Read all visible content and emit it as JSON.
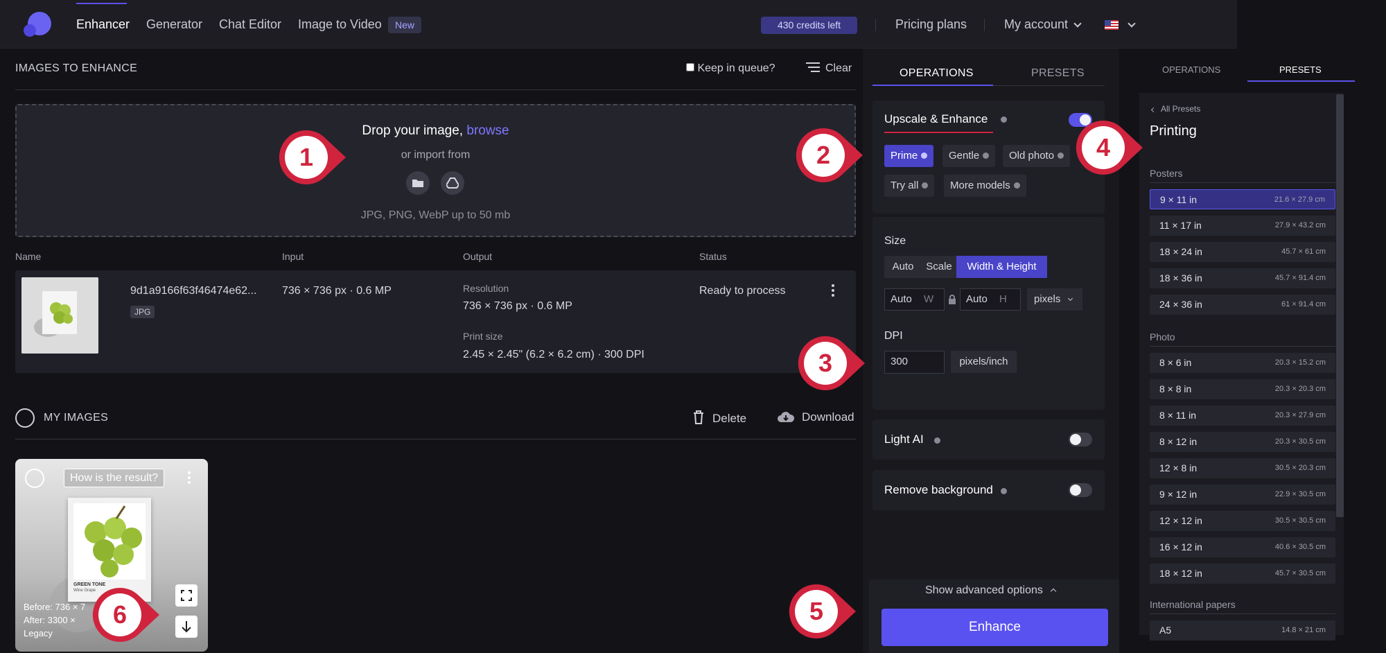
{
  "nav": {
    "items": [
      "Enhancer",
      "Generator",
      "Chat Editor",
      "Image to Video"
    ],
    "new_badge": "New",
    "credits": "430 credits left",
    "pricing": "Pricing plans",
    "account": "My account"
  },
  "images": {
    "title": "IMAGES TO ENHANCE",
    "keep_queue": "Keep in queue?",
    "clear": "Clear",
    "drop_text": "Drop your image,",
    "browse": "browse",
    "import_from": "or import from",
    "formats": "JPG, PNG, WebP up to 50 mb",
    "columns": {
      "name": "Name",
      "input": "Input",
      "output": "Output",
      "status": "Status"
    },
    "row": {
      "filename": "9d1a9166f63f46474e62...",
      "type": "JPG",
      "input": "736 × 736 px · 0.6 MP",
      "resolution_label": "Resolution",
      "resolution": "736 × 736 px · 0.6 MP",
      "print_label": "Print size",
      "print_size": "2.45 × 2.45\" (6.2 × 6.2 cm) · 300 DPI",
      "status": "Ready to process"
    }
  },
  "my_images": {
    "title": "MY IMAGES",
    "delete": "Delete",
    "download": "Download",
    "card": {
      "question": "How is the result?",
      "before": "Before:  736 × 7",
      "after": "After:    3300 ×",
      "model": "Legacy",
      "poster_title": "GREEN TONE",
      "poster_sub": "Wine Grape"
    }
  },
  "operations": {
    "tab_operations": "OPERATIONS",
    "tab_presets": "PRESETS",
    "upscale_title": "Upscale & Enhance",
    "models": [
      "Prime",
      "Gentle",
      "Old photo",
      "Try all",
      "More models"
    ],
    "size_label": "Size",
    "size_modes": [
      "Auto",
      "Scale",
      "Width & Height"
    ],
    "width_value": "Auto",
    "width_hint": "W",
    "height_value": "Auto",
    "height_hint": "H",
    "unit": "pixels",
    "dpi_label": "DPI",
    "dpi_value": "300",
    "dpi_unit": "pixels/inch",
    "light_ai": "Light AI",
    "remove_bg": "Remove background",
    "advanced": "Show advanced options",
    "enhance": "Enhance"
  },
  "presets": {
    "tab_operations": "OPERATIONS",
    "tab_presets": "PRESETS",
    "back": "All Presets",
    "title": "Printing",
    "posters_label": "Posters",
    "posters": [
      {
        "size": "9 × 11 in",
        "cm": "21.6 × 27.9 cm"
      },
      {
        "size": "11 × 17 in",
        "cm": "27.9 × 43.2 cm"
      },
      {
        "size": "18 × 24 in",
        "cm": "45.7 × 61 cm"
      },
      {
        "size": "18 × 36 in",
        "cm": "45.7 × 91.4 cm"
      },
      {
        "size": "24 × 36 in",
        "cm": "61 × 91.4 cm"
      }
    ],
    "photo_label": "Photo",
    "photo": [
      {
        "size": "8 × 6 in",
        "cm": "20.3 × 15.2 cm"
      },
      {
        "size": "8 × 8 in",
        "cm": "20.3 × 20.3 cm"
      },
      {
        "size": "8 × 11 in",
        "cm": "20.3 × 27.9 cm"
      },
      {
        "size": "8 × 12 in",
        "cm": "20.3 × 30.5 cm"
      },
      {
        "size": "12 × 8 in",
        "cm": "30.5 × 20.3 cm"
      },
      {
        "size": "9 × 12 in",
        "cm": "22.9 × 30.5 cm"
      },
      {
        "size": "12 × 12 in",
        "cm": "30.5 × 30.5 cm"
      },
      {
        "size": "16 × 12 in",
        "cm": "40.6 × 30.5 cm"
      },
      {
        "size": "18 × 12 in",
        "cm": "45.7 × 30.5 cm"
      }
    ],
    "intl_label": "International papers",
    "intl": [
      {
        "size": "A5",
        "cm": "14.8 × 21 cm"
      }
    ]
  },
  "callouts": [
    "1",
    "2",
    "3",
    "4",
    "5",
    "6"
  ],
  "colors": {
    "accent": "#5a52f0",
    "callout": "#d0243e",
    "background": "#131317"
  }
}
